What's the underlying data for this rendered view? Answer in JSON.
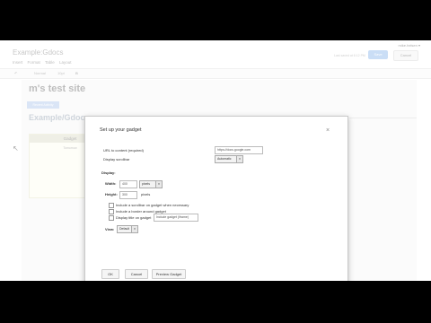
{
  "header": {
    "account": "mike.helsen ▾",
    "doc_title": "Example:Gdocs",
    "menu": [
      "Insert",
      "Format",
      "Table",
      "Layout"
    ],
    "saved_text": "Last saved at 6:12 PM",
    "save_label": "Save",
    "cancel_label": "Cancel"
  },
  "toolbar": {
    "undo": "↶",
    "font": "Normal",
    "size": "10pt",
    "bold": "B"
  },
  "page": {
    "site_title": "m's test site",
    "pill": "Recent Activity",
    "heading": "Example/Gdocs",
    "gadget_title": "Gadget",
    "gadget_text": "Tomorrow"
  },
  "dialog": {
    "title": "Set up your gadget",
    "close": "×",
    "url_label": "URL to content (required)",
    "url_value": "https://docs.google.com",
    "scrollbar_label": "Display scrollbar",
    "scrollbar_value": "Automatic",
    "display_label": "Display:",
    "width_label": "Width:",
    "width_value": "400",
    "width_unit": "pixels",
    "height_label": "Height:",
    "height_value": "300",
    "height_unit": "pixels",
    "opt_scrollbar": "Include a scrollbar on gadget when necessary",
    "opt_border": "Include a border around gadget",
    "opt_title": "Display title on gadget",
    "title_value": "Include gadget (iframe)",
    "view_label": "View:",
    "view_value": "Default",
    "ok": "OK",
    "cancel": "Cancel",
    "preview": "Preview Gadget"
  }
}
